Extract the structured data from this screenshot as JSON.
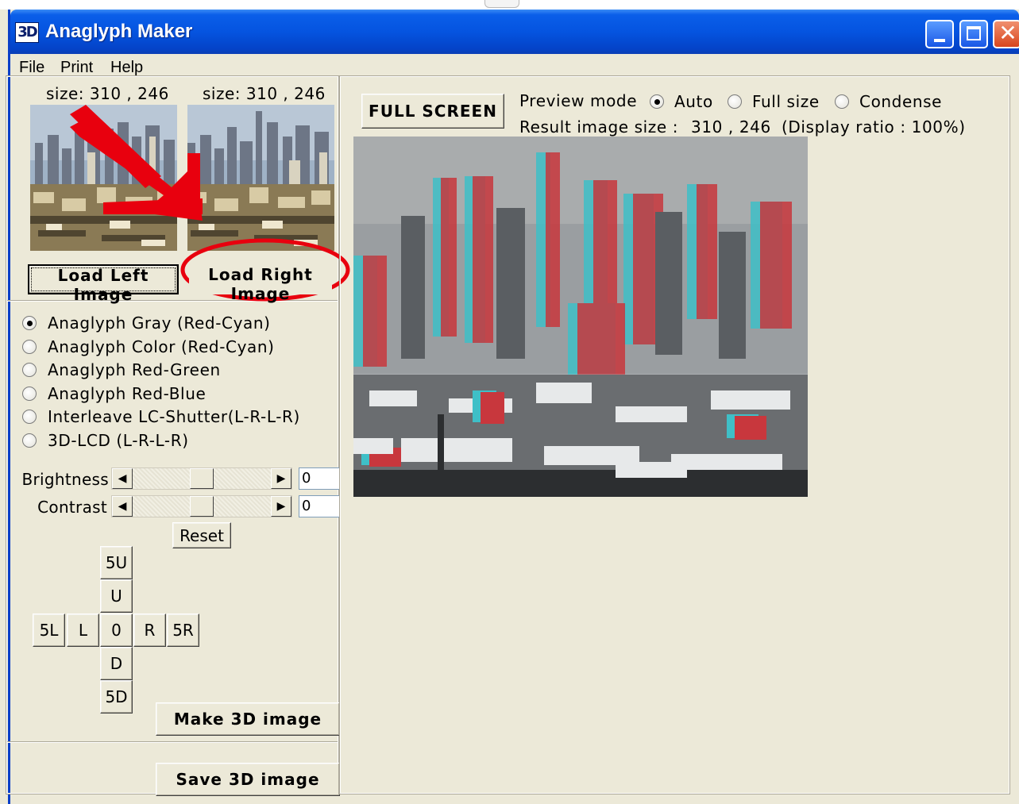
{
  "window": {
    "title": "Anaglyph Maker",
    "icon_text": "3D",
    "controls": {
      "minimize": "minimize-icon",
      "maximize": "maximize-icon",
      "close": "close-icon"
    }
  },
  "menu": {
    "file": "File",
    "print": "Print",
    "help": "Help"
  },
  "left_panel": {
    "left_size": "size: 310 , 246",
    "right_size": "size: 310 , 246",
    "load_left": "Load Left Image",
    "load_right": "Load Right Image",
    "modes": [
      {
        "label": "Anaglyph Gray (Red-Cyan)",
        "selected": true
      },
      {
        "label": "Anaglyph Color (Red-Cyan)",
        "selected": false
      },
      {
        "label": "Anaglyph Red-Green",
        "selected": false
      },
      {
        "label": "Anaglyph Red-Blue",
        "selected": false
      },
      {
        "label": "Interleave LC-Shutter(L-R-L-R)",
        "selected": false
      },
      {
        "label": "3D-LCD (L-R-L-R)",
        "selected": false
      }
    ],
    "brightness": {
      "label": "Brightness",
      "value": "0",
      "position": 0.5
    },
    "contrast": {
      "label": "Contrast",
      "value": "0",
      "position": 0.5
    },
    "reset": "Reset",
    "nudge": {
      "up5": "5U",
      "up": "U",
      "left5": "5L",
      "left": "L",
      "center": "0",
      "right": "R",
      "right5": "5R",
      "down": "D",
      "down5": "5D"
    },
    "make": "Make 3D image",
    "save": "Save 3D image"
  },
  "right_panel": {
    "full_screen": "FULL SCREEN",
    "preview_mode_label": "Preview mode",
    "preview_options": [
      {
        "label": "Auto",
        "selected": true
      },
      {
        "label": "Full size",
        "selected": false
      },
      {
        "label": "Condense",
        "selected": false
      }
    ],
    "result_label": "Result image size :",
    "result_size": "310 , 246",
    "display_ratio": "(Display ratio : 100%)"
  },
  "colors": {
    "title_bar": "#0554e0",
    "window_bg": "#ece9d8",
    "annotation_red": "#e8000e"
  }
}
